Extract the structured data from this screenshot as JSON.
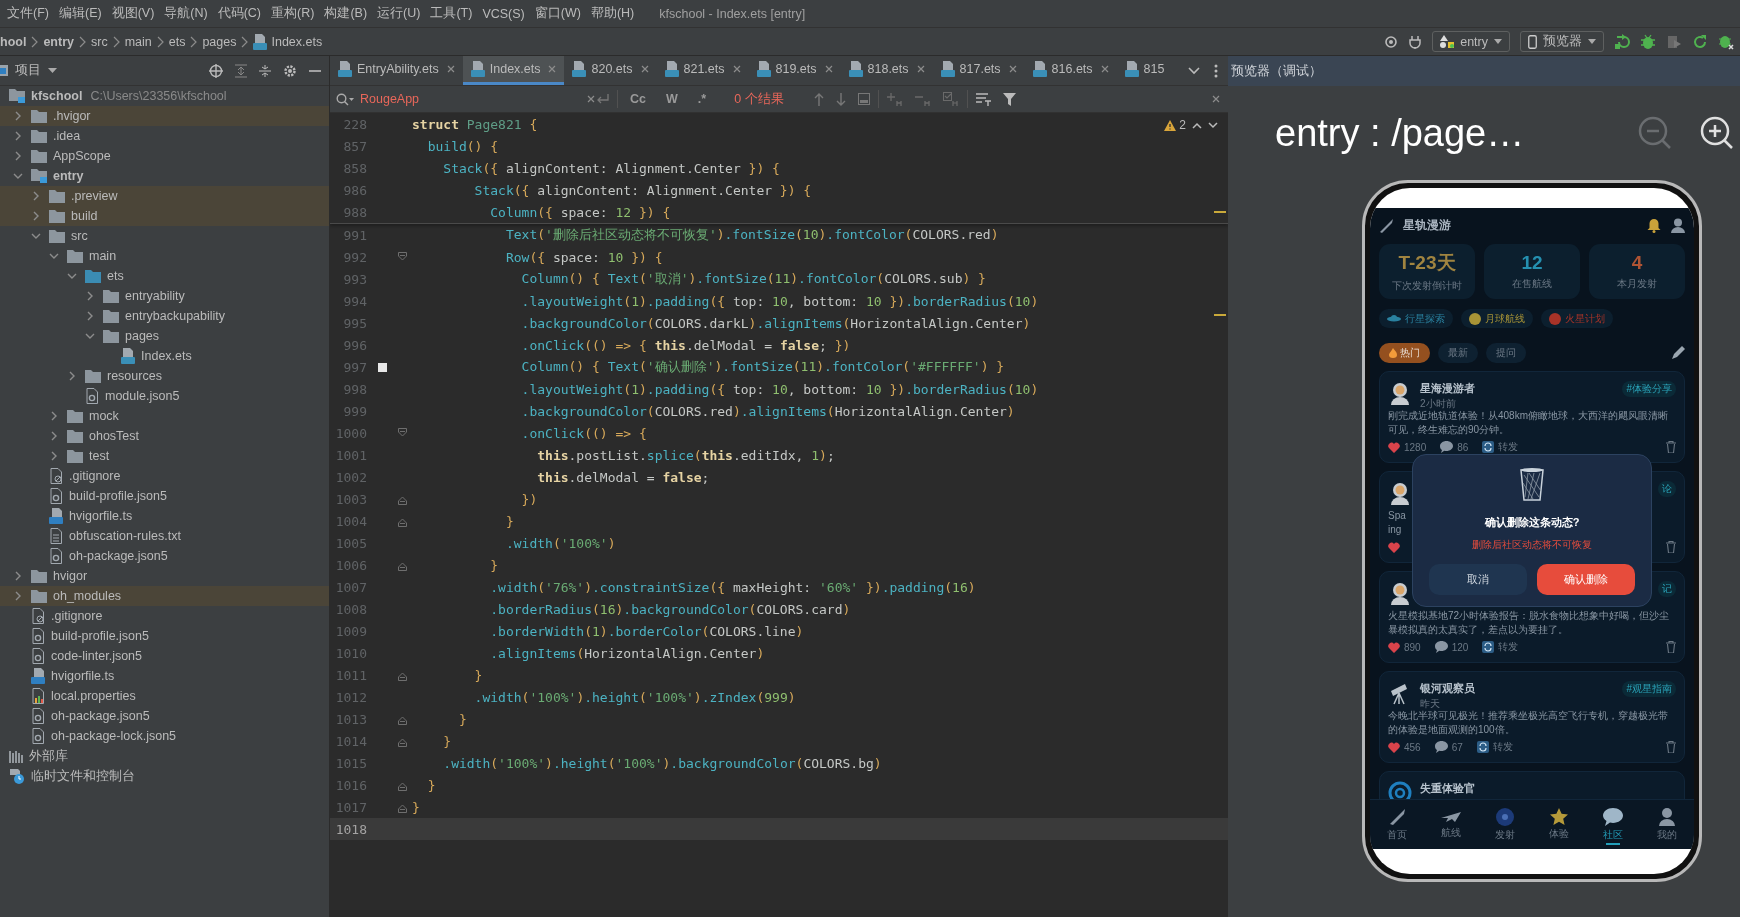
{
  "menu_bar": {
    "items": [
      "文件(F)",
      "编辑(E)",
      "视图(V)",
      "导航(N)",
      "代码(C)",
      "重构(R)",
      "构建(B)",
      "运行(U)",
      "工具(T)",
      "VCS(S)",
      "窗口(W)",
      "帮助(H)"
    ],
    "title": "kfschool - Index.ets [entry]"
  },
  "breadcrumb": [
    {
      "label": "hool",
      "kind": "module"
    },
    {
      "label": "entry",
      "kind": "module"
    },
    {
      "label": "src",
      "kind": "folder"
    },
    {
      "label": "main",
      "kind": "folder"
    },
    {
      "label": "ets",
      "kind": "folder"
    },
    {
      "label": "pages",
      "kind": "folder"
    },
    {
      "label": "Index.ets",
      "kind": "ets"
    }
  ],
  "toolbar": {
    "run_config": "entry",
    "device": "预览器"
  },
  "project_panel": {
    "title": "项目",
    "tree": [
      {
        "label": "kfschool",
        "kind": "module",
        "path": "C:\\Users\\23356\\kfschool",
        "excluded": false,
        "children": [
          {
            "label": ".hvigor",
            "kind": "folder",
            "excluded": true,
            "expanded": false
          },
          {
            "label": ".idea",
            "kind": "folder",
            "excluded": false,
            "expanded": false
          },
          {
            "label": "AppScope",
            "kind": "folder",
            "excluded": false,
            "expanded": false
          },
          {
            "label": "entry",
            "kind": "module",
            "excluded": false,
            "expanded": true,
            "children": [
              {
                "label": ".preview",
                "kind": "folder",
                "excluded": true,
                "expanded": false
              },
              {
                "label": "build",
                "kind": "folder",
                "excluded": true,
                "expanded": false
              },
              {
                "label": "src",
                "kind": "folder",
                "excluded": false,
                "expanded": true,
                "children": [
                  {
                    "label": "main",
                    "kind": "folder",
                    "excluded": false,
                    "expanded": true,
                    "children": [
                      {
                        "label": "ets",
                        "kind": "source",
                        "excluded": false,
                        "expanded": true,
                        "children": [
                          {
                            "label": "entryability",
                            "kind": "folder",
                            "excluded": false,
                            "expanded": false
                          },
                          {
                            "label": "entrybackupability",
                            "kind": "folder",
                            "excluded": false,
                            "expanded": false
                          },
                          {
                            "label": "pages",
                            "kind": "folder",
                            "excluded": false,
                            "expanded": true,
                            "children": [
                              {
                                "label": "Index.ets",
                                "kind": "ets"
                              }
                            ]
                          }
                        ]
                      },
                      {
                        "label": "resources",
                        "kind": "folder",
                        "excluded": false,
                        "expanded": false
                      },
                      {
                        "label": "module.json5",
                        "kind": "json"
                      }
                    ]
                  },
                  {
                    "label": "mock",
                    "kind": "folder",
                    "excluded": false,
                    "expanded": false
                  },
                  {
                    "label": "ohosTest",
                    "kind": "folder",
                    "excluded": false,
                    "expanded": false
                  },
                  {
                    "label": "test",
                    "kind": "folder",
                    "excluded": false,
                    "expanded": false
                  }
                ]
              },
              {
                "label": ".gitignore",
                "kind": "ignore"
              },
              {
                "label": "build-profile.json5",
                "kind": "json"
              },
              {
                "label": "hvigorfile.ts",
                "kind": "ts"
              },
              {
                "label": "obfuscation-rules.txt",
                "kind": "txt"
              },
              {
                "label": "oh-package.json5",
                "kind": "json"
              }
            ]
          },
          {
            "label": "hvigor",
            "kind": "folder",
            "excluded": false,
            "expanded": false
          },
          {
            "label": "oh_modules",
            "kind": "folder",
            "excluded": true,
            "expanded": false
          },
          {
            "label": ".gitignore",
            "kind": "ignore"
          },
          {
            "label": "build-profile.json5",
            "kind": "json"
          },
          {
            "label": "code-linter.json5",
            "kind": "json"
          },
          {
            "label": "hvigorfile.ts",
            "kind": "ts"
          },
          {
            "label": "local.properties",
            "kind": "props"
          },
          {
            "label": "oh-package.json5",
            "kind": "json"
          },
          {
            "label": "oh-package-lock.json5",
            "kind": "json"
          }
        ]
      },
      {
        "label": "外部库",
        "kind": "library"
      },
      {
        "label": "临时文件和控制台",
        "kind": "scratch"
      }
    ]
  },
  "editor": {
    "tabs": [
      {
        "label": "EntryAbility.ets",
        "selected": false,
        "closable": true
      },
      {
        "label": "Index.ets",
        "selected": true,
        "closable": true
      },
      {
        "label": "820.ets",
        "selected": false,
        "closable": true
      },
      {
        "label": "821.ets",
        "selected": false,
        "closable": true
      },
      {
        "label": "819.ets",
        "selected": false,
        "closable": true
      },
      {
        "label": "818.ets",
        "selected": false,
        "closable": true
      },
      {
        "label": "817.ets",
        "selected": false,
        "closable": true
      },
      {
        "label": "816.ets",
        "selected": false,
        "closable": true
      },
      {
        "label": "815",
        "selected": false,
        "closable": false
      }
    ],
    "search": {
      "value": "RougeApp",
      "options": [
        {
          "label": "Cc",
          "on": false
        },
        {
          "label": "W",
          "on": false
        },
        {
          "label": ".*",
          "on": false
        }
      ],
      "result": "0 个结果"
    },
    "warnings": "2",
    "sticky_lines": [
      {
        "number": "228",
        "tokens": [
          {
            "kind": "keyword",
            "text": "struct "
          },
          {
            "kind": "type",
            "text": "Page821"
          },
          {
            "kind": "bracket",
            "text": " {"
          }
        ]
      },
      {
        "number": "857",
        "tokens": [
          {
            "kind": "call",
            "text": "  build"
          },
          {
            "kind": "bracket",
            "text": "() {"
          }
        ]
      },
      {
        "number": "858",
        "tokens": [
          {
            "kind": "call",
            "text": "    Stack"
          },
          {
            "kind": "bracket",
            "text": "({"
          },
          {
            "kind": "plain",
            "text": " alignContent: Alignment.Center "
          },
          {
            "kind": "bracket",
            "text": "}) {"
          }
        ]
      },
      {
        "number": "986",
        "tokens": [
          {
            "kind": "call",
            "text": "        Stack"
          },
          {
            "kind": "bracket",
            "text": "({"
          },
          {
            "kind": "plain",
            "text": " alignContent: Alignment.Center "
          },
          {
            "kind": "bracket",
            "text": "}) {"
          }
        ]
      },
      {
        "number": "988",
        "tokens": [
          {
            "kind": "call",
            "text": "          Column"
          },
          {
            "kind": "bracket",
            "text": "({"
          },
          {
            "kind": "plain",
            "text": " space: "
          },
          {
            "kind": "number",
            "text": "12"
          },
          {
            "kind": "bracket",
            "text": " }) {"
          }
        ]
      }
    ],
    "lines": [
      {
        "number": "991",
        "current": false,
        "bookmark": false,
        "tokens": [
          {
            "kind": "call",
            "text": "            Text"
          },
          {
            "kind": "bracket",
            "text": "("
          },
          {
            "kind": "string",
            "text": "'删除后社区动态将不可恢复'"
          },
          {
            "kind": "bracket",
            "text": ")"
          },
          {
            "kind": "call",
            "text": ".fontSize"
          },
          {
            "kind": "bracket",
            "text": "("
          },
          {
            "kind": "number",
            "text": "10"
          },
          {
            "kind": "bracket",
            "text": ")"
          },
          {
            "kind": "call",
            "text": ".fontColor"
          },
          {
            "kind": "bracket",
            "text": "("
          },
          {
            "kind": "plain",
            "text": "COLORS.red"
          },
          {
            "kind": "bracket",
            "text": ")"
          }
        ]
      },
      {
        "number": "992",
        "current": false,
        "bookmark": false,
        "kind": "fold_start",
        "tokens": [
          {
            "kind": "call",
            "text": "            Row"
          },
          {
            "kind": "bracket",
            "text": "({"
          },
          {
            "kind": "plain",
            "text": " space: "
          },
          {
            "kind": "number",
            "text": "10"
          },
          {
            "kind": "bracket",
            "text": " }) {"
          }
        ]
      },
      {
        "number": "993",
        "current": false,
        "bookmark": false,
        "tokens": [
          {
            "kind": "call",
            "text": "              Column"
          },
          {
            "kind": "bracket",
            "text": "() { "
          },
          {
            "kind": "call",
            "text": "Text"
          },
          {
            "kind": "bracket",
            "text": "("
          },
          {
            "kind": "string",
            "text": "'取消'"
          },
          {
            "kind": "bracket",
            "text": ")"
          },
          {
            "kind": "call",
            "text": ".fontSize"
          },
          {
            "kind": "bracket",
            "text": "("
          },
          {
            "kind": "number",
            "text": "11"
          },
          {
            "kind": "bracket",
            "text": ")"
          },
          {
            "kind": "call",
            "text": ".fontColor"
          },
          {
            "kind": "bracket",
            "text": "("
          },
          {
            "kind": "plain",
            "text": "COLORS.sub"
          },
          {
            "kind": "bracket",
            "text": ") }"
          }
        ]
      },
      {
        "number": "994",
        "current": false,
        "bookmark": false,
        "tokens": [
          {
            "kind": "call",
            "text": "              .layoutWeight"
          },
          {
            "kind": "bracket",
            "text": "("
          },
          {
            "kind": "number",
            "text": "1"
          },
          {
            "kind": "bracket",
            "text": ")"
          },
          {
            "kind": "call",
            "text": ".padding"
          },
          {
            "kind": "bracket",
            "text": "({"
          },
          {
            "kind": "plain",
            "text": " top: "
          },
          {
            "kind": "number",
            "text": "10"
          },
          {
            "kind": "plain",
            "text": ", bottom: "
          },
          {
            "kind": "number",
            "text": "10"
          },
          {
            "kind": "bracket",
            "text": " })"
          },
          {
            "kind": "call",
            "text": ".borderRadius"
          },
          {
            "kind": "bracket",
            "text": "("
          },
          {
            "kind": "number",
            "text": "10"
          },
          {
            "kind": "bracket",
            "text": ")"
          }
        ]
      },
      {
        "number": "995",
        "current": false,
        "bookmark": false,
        "tokens": [
          {
            "kind": "call",
            "text": "              .backgroundColor"
          },
          {
            "kind": "bracket",
            "text": "("
          },
          {
            "kind": "plain",
            "text": "COLORS.darkL"
          },
          {
            "kind": "bracket",
            "text": ")"
          },
          {
            "kind": "call",
            "text": ".alignItems"
          },
          {
            "kind": "bracket",
            "text": "("
          },
          {
            "kind": "plain",
            "text": "HorizontalAlign.Center"
          },
          {
            "kind": "bracket",
            "text": ")"
          }
        ]
      },
      {
        "number": "996",
        "current": false,
        "bookmark": false,
        "tokens": [
          {
            "kind": "call",
            "text": "              .onClick"
          },
          {
            "kind": "bracket",
            "text": "(() => { "
          },
          {
            "kind": "keyword",
            "text": "this"
          },
          {
            "kind": "plain",
            "text": ".delModal = "
          },
          {
            "kind": "keyword",
            "text": "false"
          },
          {
            "kind": "plain",
            "text": "; "
          },
          {
            "kind": "bracket",
            "text": "})"
          }
        ]
      },
      {
        "number": "997",
        "current": false,
        "bookmark": true,
        "tokens": [
          {
            "kind": "call",
            "text": "              Column"
          },
          {
            "kind": "bracket",
            "text": "() { "
          },
          {
            "kind": "call",
            "text": "Text"
          },
          {
            "kind": "bracket",
            "text": "("
          },
          {
            "kind": "string",
            "text": "'确认删除'"
          },
          {
            "kind": "bracket",
            "text": ")"
          },
          {
            "kind": "call",
            "text": ".fontSize"
          },
          {
            "kind": "bracket",
            "text": "("
          },
          {
            "kind": "number",
            "text": "11"
          },
          {
            "kind": "bracket",
            "text": ")"
          },
          {
            "kind": "call",
            "text": ".fontColor"
          },
          {
            "kind": "bracket",
            "text": "("
          },
          {
            "kind": "string",
            "text": "'#FFFFFF'"
          },
          {
            "kind": "bracket",
            "text": ") }"
          }
        ]
      },
      {
        "number": "998",
        "current": false,
        "bookmark": false,
        "tokens": [
          {
            "kind": "call",
            "text": "              .layoutWeight"
          },
          {
            "kind": "bracket",
            "text": "("
          },
          {
            "kind": "number",
            "text": "1"
          },
          {
            "kind": "bracket",
            "text": ")"
          },
          {
            "kind": "call",
            "text": ".padding"
          },
          {
            "kind": "bracket",
            "text": "({"
          },
          {
            "kind": "plain",
            "text": " top: "
          },
          {
            "kind": "number",
            "text": "10"
          },
          {
            "kind": "plain",
            "text": ", bottom: "
          },
          {
            "kind": "number",
            "text": "10"
          },
          {
            "kind": "bracket",
            "text": " })"
          },
          {
            "kind": "call",
            "text": ".borderRadius"
          },
          {
            "kind": "bracket",
            "text": "("
          },
          {
            "kind": "number",
            "text": "10"
          },
          {
            "kind": "bracket",
            "text": ")"
          }
        ]
      },
      {
        "number": "999",
        "current": false,
        "bookmark": false,
        "tokens": [
          {
            "kind": "call",
            "text": "              .backgroundColor"
          },
          {
            "kind": "bracket",
            "text": "("
          },
          {
            "kind": "plain",
            "text": "COLORS.red"
          },
          {
            "kind": "bracket",
            "text": ")"
          },
          {
            "kind": "call",
            "text": ".alignItems"
          },
          {
            "kind": "bracket",
            "text": "("
          },
          {
            "kind": "plain",
            "text": "HorizontalAlign.Center"
          },
          {
            "kind": "bracket",
            "text": ")"
          }
        ]
      },
      {
        "number": "1000",
        "current": false,
        "bookmark": false,
        "kind": "fold_start",
        "tokens": [
          {
            "kind": "call",
            "text": "              .onClick"
          },
          {
            "kind": "bracket",
            "text": "(() => {"
          }
        ]
      },
      {
        "number": "1001",
        "current": false,
        "bookmark": false,
        "tokens": [
          {
            "kind": "keyword",
            "text": "                this"
          },
          {
            "kind": "plain",
            "text": ".postList."
          },
          {
            "kind": "call",
            "text": "splice"
          },
          {
            "kind": "bracket",
            "text": "("
          },
          {
            "kind": "keyword",
            "text": "this"
          },
          {
            "kind": "plain",
            "text": ".editIdx, "
          },
          {
            "kind": "number",
            "text": "1"
          },
          {
            "kind": "bracket",
            "text": ")"
          },
          {
            "kind": "plain",
            "text": ";"
          }
        ]
      },
      {
        "number": "1002",
        "current": false,
        "bookmark": false,
        "tokens": [
          {
            "kind": "keyword",
            "text": "                this"
          },
          {
            "kind": "plain",
            "text": ".delModal = "
          },
          {
            "kind": "keyword",
            "text": "false"
          },
          {
            "kind": "plain",
            "text": ";"
          }
        ]
      },
      {
        "number": "1003",
        "current": false,
        "bookmark": false,
        "kind": "fold_end",
        "tokens": [
          {
            "kind": "bracket",
            "text": "              })"
          }
        ]
      },
      {
        "number": "1004",
        "current": false,
        "bookmark": false,
        "kind": "fold_end",
        "tokens": [
          {
            "kind": "bracket",
            "text": "            }"
          }
        ]
      },
      {
        "number": "1005",
        "current": false,
        "bookmark": false,
        "tokens": [
          {
            "kind": "call",
            "text": "            .width"
          },
          {
            "kind": "bracket",
            "text": "("
          },
          {
            "kind": "string",
            "text": "'100%'"
          },
          {
            "kind": "bracket",
            "text": ")"
          }
        ]
      },
      {
        "number": "1006",
        "current": false,
        "bookmark": false,
        "kind": "fold_end",
        "tokens": [
          {
            "kind": "bracket",
            "text": "          }"
          }
        ]
      },
      {
        "number": "1007",
        "current": false,
        "bookmark": false,
        "tokens": [
          {
            "kind": "call",
            "text": "          .width"
          },
          {
            "kind": "bracket",
            "text": "("
          },
          {
            "kind": "string",
            "text": "'76%'"
          },
          {
            "kind": "bracket",
            "text": ")"
          },
          {
            "kind": "call",
            "text": ".constraintSize"
          },
          {
            "kind": "bracket",
            "text": "({"
          },
          {
            "kind": "plain",
            "text": " maxHeight: "
          },
          {
            "kind": "string",
            "text": "'60%'"
          },
          {
            "kind": "bracket",
            "text": " })"
          },
          {
            "kind": "call",
            "text": ".padding"
          },
          {
            "kind": "bracket",
            "text": "("
          },
          {
            "kind": "number",
            "text": "16"
          },
          {
            "kind": "bracket",
            "text": ")"
          }
        ]
      },
      {
        "number": "1008",
        "current": false,
        "bookmark": false,
        "tokens": [
          {
            "kind": "call",
            "text": "          .borderRadius"
          },
          {
            "kind": "bracket",
            "text": "("
          },
          {
            "kind": "number",
            "text": "16"
          },
          {
            "kind": "bracket",
            "text": ")"
          },
          {
            "kind": "call",
            "text": ".backgroundColor"
          },
          {
            "kind": "bracket",
            "text": "("
          },
          {
            "kind": "plain",
            "text": "COLORS.card"
          },
          {
            "kind": "bracket",
            "text": ")"
          }
        ]
      },
      {
        "number": "1009",
        "current": false,
        "bookmark": false,
        "tokens": [
          {
            "kind": "call",
            "text": "          .borderWidth"
          },
          {
            "kind": "bracket",
            "text": "("
          },
          {
            "kind": "number",
            "text": "1"
          },
          {
            "kind": "bracket",
            "text": ")"
          },
          {
            "kind": "call",
            "text": ".borderColor"
          },
          {
            "kind": "bracket",
            "text": "("
          },
          {
            "kind": "plain",
            "text": "COLORS.line"
          },
          {
            "kind": "bracket",
            "text": ")"
          }
        ]
      },
      {
        "number": "1010",
        "current": false,
        "bookmark": false,
        "tokens": [
          {
            "kind": "call",
            "text": "          .alignItems"
          },
          {
            "kind": "bracket",
            "text": "("
          },
          {
            "kind": "plain",
            "text": "HorizontalAlign.Center"
          },
          {
            "kind": "bracket",
            "text": ")"
          }
        ]
      },
      {
        "number": "1011",
        "current": false,
        "bookmark": false,
        "kind": "fold_end",
        "tokens": [
          {
            "kind": "bracket",
            "text": "        }"
          }
        ]
      },
      {
        "number": "1012",
        "current": false,
        "bookmark": false,
        "tokens": [
          {
            "kind": "call",
            "text": "        .width"
          },
          {
            "kind": "bracket",
            "text": "("
          },
          {
            "kind": "string",
            "text": "'100%'"
          },
          {
            "kind": "bracket",
            "text": ")"
          },
          {
            "kind": "call",
            "text": ".height"
          },
          {
            "kind": "bracket",
            "text": "("
          },
          {
            "kind": "string",
            "text": "'100%'"
          },
          {
            "kind": "bracket",
            "text": ")"
          },
          {
            "kind": "call",
            "text": ".zIndex"
          },
          {
            "kind": "bracket",
            "text": "("
          },
          {
            "kind": "number",
            "text": "999"
          },
          {
            "kind": "bracket",
            "text": ")"
          }
        ]
      },
      {
        "number": "1013",
        "current": false,
        "bookmark": false,
        "kind": "fold_end",
        "tokens": [
          {
            "kind": "bracket",
            "text": "      }"
          }
        ]
      },
      {
        "number": "1014",
        "current": false,
        "bookmark": false,
        "kind": "fold_end",
        "tokens": [
          {
            "kind": "bracket",
            "text": "    }"
          }
        ]
      },
      {
        "number": "1015",
        "current": false,
        "bookmark": false,
        "tokens": [
          {
            "kind": "call",
            "text": "    .width"
          },
          {
            "kind": "bracket",
            "text": "("
          },
          {
            "kind": "string",
            "text": "'100%'"
          },
          {
            "kind": "bracket",
            "text": ")"
          },
          {
            "kind": "call",
            "text": ".height"
          },
          {
            "kind": "bracket",
            "text": "("
          },
          {
            "kind": "string",
            "text": "'100%'"
          },
          {
            "kind": "bracket",
            "text": ")"
          },
          {
            "kind": "call",
            "text": ".backgroundColor"
          },
          {
            "kind": "bracket",
            "text": "("
          },
          {
            "kind": "plain",
            "text": "COLORS.bg"
          },
          {
            "kind": "bracket",
            "text": ")"
          }
        ]
      },
      {
        "number": "1016",
        "current": false,
        "bookmark": false,
        "kind": "fold_end",
        "tokens": [
          {
            "kind": "bracket",
            "text": "  }"
          }
        ]
      },
      {
        "number": "1017",
        "current": false,
        "bookmark": false,
        "kind": "fold_end",
        "tokens": [
          {
            "kind": "bracket",
            "text": "}"
          }
        ]
      },
      {
        "number": "1018",
        "current": true,
        "bookmark": false
      }
    ]
  },
  "preview": {
    "title": "预览器（调试）",
    "route": "entry : /page…",
    "app": {
      "title": "星轨漫游",
      "stats": [
        {
          "value": "T-23天",
          "label": "下次发射倒计时",
          "color": "#a08440"
        },
        {
          "value": "12",
          "label": "在售航线",
          "color": "#2590b0"
        },
        {
          "value": "4",
          "label": "本月发射",
          "color": "#b05434"
        }
      ],
      "chips": [
        {
          "label": "行星探索",
          "kind": "ship",
          "color": "#2a82a0"
        },
        {
          "label": "月球航线",
          "kind": "dot",
          "color": "#a89436"
        },
        {
          "label": "火星计划",
          "kind": "dot",
          "color": "#a83328"
        }
      ],
      "feed_tabs": [
        {
          "label": "热门",
          "selected": true
        },
        {
          "label": "最新",
          "selected": false
        },
        {
          "label": "提问",
          "selected": false
        }
      ],
      "posts": [
        {
          "kind": "astronaut",
          "name": "星海漫游者",
          "time": "2小时前",
          "tag": "#体验分享",
          "body": "刚完成近地轨道体验！从408km俯瞰地球，大西洋的飓风眼清晰可见，终生难忘的90分钟。",
          "actions": [
            {
              "kind": "like",
              "count": "1280"
            },
            {
              "kind": "comment",
              "count": "86"
            },
            {
              "kind": "share",
              "count": "转发"
            }
          ]
        },
        {
          "kind": "astronaut",
          "tag": "论",
          "body": "Spa\ning",
          "actions": [
            {
              "kind": "like"
            }
          ]
        },
        {
          "kind": "astronaut",
          "tag": "记",
          "body": "火星模拟基地72小时体验报告：脱水食物比想象中好喝，但沙尘暴模拟真的太真实了，差点以为要挂了。",
          "actions": [
            {
              "kind": "like",
              "count": "890"
            },
            {
              "kind": "comment",
              "count": "120"
            },
            {
              "kind": "share",
              "count": "转发"
            }
          ]
        },
        {
          "kind": "telescope",
          "name": "银河观察员",
          "time": "昨天",
          "tag": "#观星指南",
          "body": "今晚北半球可见极光！推荐乘坐极光高空飞行专机，穿越极光带的体验是地面观测的100倍。",
          "actions": [
            {
              "kind": "like",
              "count": "456"
            },
            {
              "kind": "comment",
              "count": "67"
            },
            {
              "kind": "share",
              "count": "转发"
            }
          ]
        },
        {
          "kind": "ring",
          "name": "失重体验官"
        }
      ],
      "modal": {
        "title": "确认删除这条动态?",
        "message": "删除后社区动态将不可恢复",
        "buttons": [
          {
            "label": "取消",
            "kind": "secondary"
          },
          {
            "label": "确认删除",
            "kind": "danger"
          }
        ]
      },
      "nav": [
        {
          "label": "首页",
          "kind": "rocket",
          "selected": false
        },
        {
          "label": "航线",
          "kind": "plane",
          "selected": false
        },
        {
          "label": "发射",
          "kind": "galaxy",
          "selected": false
        },
        {
          "label": "体验",
          "kind": "star",
          "selected": false
        },
        {
          "label": "社区",
          "kind": "chat",
          "selected": true
        },
        {
          "label": "我的",
          "kind": "person",
          "selected": false
        }
      ]
    }
  }
}
